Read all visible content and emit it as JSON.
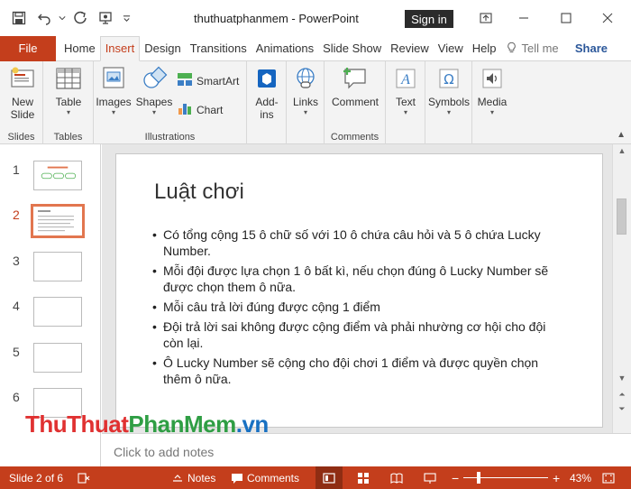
{
  "window": {
    "title": "thuthuatphanmem  -  PowerPoint",
    "signin_label": "Sign in"
  },
  "tabs": {
    "file": "File",
    "items": [
      "Home",
      "Insert",
      "Design",
      "Transitions",
      "Animations",
      "Slide Show",
      "Review",
      "View",
      "Help"
    ],
    "active": "Insert",
    "tell_me": "Tell me",
    "share": "Share"
  },
  "ribbon": {
    "groups": {
      "slides": "Slides",
      "tables": "Tables",
      "illustrations": "Illustrations",
      "comments": "Comments"
    },
    "buttons": {
      "new_slide": "New",
      "new_slide_2": "Slide",
      "table": "Table",
      "images": "Images",
      "shapes": "Shapes",
      "smartart": "SmartArt",
      "chart": "Chart",
      "addins": "Add-",
      "addins_2": "ins",
      "links": "Links",
      "comment": "Comment",
      "text": "Text",
      "symbols": "Symbols",
      "media": "Media"
    }
  },
  "thumbnails": {
    "numbers": [
      "1",
      "2",
      "3",
      "4",
      "5",
      "6"
    ],
    "active_index": 1
  },
  "slide": {
    "title": "Luật chơi",
    "bullets": [
      "Có tổng cộng 15 ô chữ số với 10 ô chứa câu hỏi và 5 ô chứa Lucky Number.",
      "Mỗi đội được lựa chọn 1 ô bất kì, nếu chọn đúng ô Lucky Number sẽ được chọn them ô nữa.",
      " Mỗi câu trả lời đúng được cộng 1 điểm",
      "Đội trả lời sai không được cộng điểm và phải nhường cơ hội cho đội còn lại.",
      "Ô Lucky Number sẽ cộng cho đội chơi 1 điểm và được quyền chọn thêm ô nữa."
    ]
  },
  "notes": {
    "placeholder": "Click to add notes"
  },
  "watermark": {
    "part1": "ThuThuat",
    "part2": "PhanMem",
    "part3": ".vn"
  },
  "status": {
    "slide_info": "Slide 2 of 6",
    "notes_label": "Notes",
    "comments_label": "Comments",
    "zoom": "43%",
    "zoom_level": 0.43
  },
  "colors": {
    "accent": "#c43e1c",
    "active_thumb": "#e2764f"
  }
}
